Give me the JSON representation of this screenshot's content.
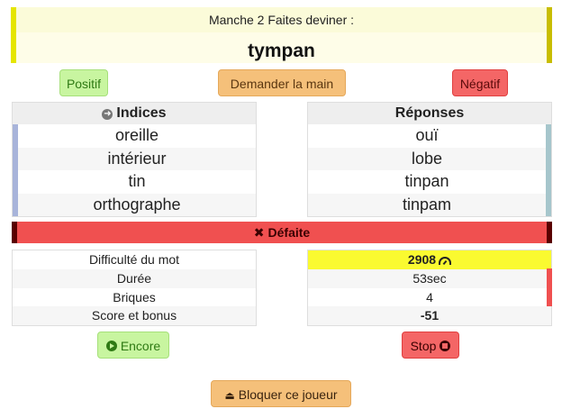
{
  "header": {
    "round_text": "Manche 2 Faites deviner :",
    "word": "tympan"
  },
  "actions": {
    "positive": "Positif",
    "ask_hand": "Demander la main",
    "negative": "Négatif"
  },
  "clues": {
    "title": "Indices",
    "items": [
      "oreille",
      "intérieur",
      "tin",
      "orthographe"
    ]
  },
  "answers": {
    "title": "Réponses",
    "items": [
      "ouï",
      "lobe",
      "tinpan",
      "tinpam"
    ]
  },
  "result": {
    "label": "Défaite",
    "icon": "x-icon"
  },
  "stats": {
    "labels": [
      "Difficulté du mot",
      "Durée",
      "Briques",
      "Score et bonus"
    ],
    "values": [
      "2908",
      "53sec",
      "4",
      "-51"
    ]
  },
  "footer": {
    "again": "Encore",
    "stop": "Stop",
    "block": "Bloquer ce joueur"
  },
  "colors": {
    "header_accent": "#e5e500",
    "positive": "#c8f5a0",
    "ask": "#f5c07a",
    "negative": "#f46666",
    "defeat": "#f05050",
    "difficulty_highlight": "#fafa30"
  }
}
